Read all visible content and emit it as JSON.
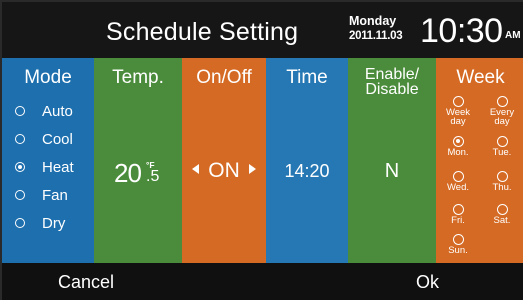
{
  "header": {
    "title": "Schedule Setting",
    "day": "Monday",
    "date": "2011.11.03",
    "time": "10:30",
    "ampm": "AM"
  },
  "mode": {
    "label": "Mode",
    "options": [
      "Auto",
      "Cool",
      "Heat",
      "Fan",
      "Dry"
    ],
    "selected": "Heat"
  },
  "temp": {
    "label": "Temp.",
    "integer": "20",
    "decimal": ".5",
    "unit": "°F"
  },
  "onoff": {
    "label": "On/Off",
    "value": "ON"
  },
  "time": {
    "label": "Time",
    "value": "14:20"
  },
  "enable": {
    "label_line1": "Enable/",
    "label_line2": "Disable",
    "value": "N"
  },
  "week": {
    "label": "Week",
    "options": [
      {
        "line1": "Week",
        "line2": "day",
        "selected": false
      },
      {
        "line1": "Every",
        "line2": "day",
        "selected": false
      },
      {
        "line1": "Mon.",
        "line2": "",
        "selected": true
      },
      {
        "line1": "Tue.",
        "line2": "",
        "selected": false
      },
      {
        "line1": "Wed.",
        "line2": "",
        "selected": false
      },
      {
        "line1": "Thu.",
        "line2": "",
        "selected": false
      },
      {
        "line1": "Fri.",
        "line2": "",
        "selected": false
      },
      {
        "line1": "Sat.",
        "line2": "",
        "selected": false
      },
      {
        "line1": "Sun.",
        "line2": "",
        "selected": false
      }
    ]
  },
  "footer": {
    "cancel": "Cancel",
    "ok": "Ok"
  },
  "colors": {
    "blue": "#1d6fae",
    "green": "#4b8c3c",
    "orange": "#d46a24",
    "background": "#111111"
  }
}
